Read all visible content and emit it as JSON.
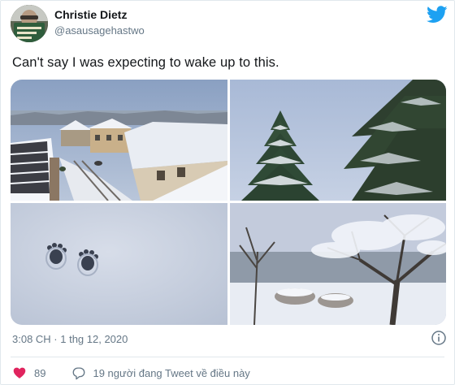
{
  "author": {
    "name": "Christie Dietz",
    "handle": "@asausagehastwo"
  },
  "tweet": {
    "text": "Can't say I was expecting to wake up to this."
  },
  "photos": [
    {
      "label": "snowy-village-street"
    },
    {
      "label": "snowy-fir-trees"
    },
    {
      "label": "paw-prints-in-snow"
    },
    {
      "label": "snowy-garden-tree"
    }
  ],
  "meta": {
    "timestamp": "3:08 CH · 1 thg 12, 2020"
  },
  "actions": {
    "like_count": "89",
    "reply_label": "19 người đang Tweet về điều này"
  },
  "colors": {
    "twitter_blue": "#1da1f2",
    "muted": "#657786",
    "like_red": "#e0245e"
  },
  "icons": {
    "brand": "twitter-bird-icon",
    "info": "info-icon",
    "like": "heart-icon",
    "reply": "comment-icon"
  }
}
